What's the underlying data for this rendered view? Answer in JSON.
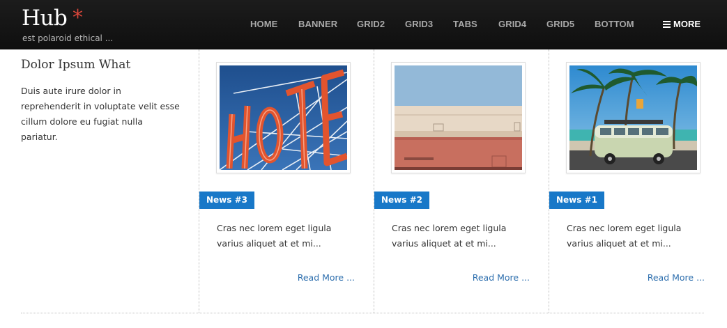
{
  "header": {
    "logo": "Hub",
    "logo_mark": "*",
    "tagline": "est polaroid ethical ...",
    "nav": [
      "HOME",
      "BANNER",
      "GRID2",
      "GRID3",
      "TABS",
      "GRID4",
      "GRID5",
      "BOTTOM"
    ],
    "more_label": "MORE",
    "more_icon": "menu-icon"
  },
  "intro": {
    "title": "Dolor Ipsum What",
    "text": "Duis aute irure dolor in reprehenderit in voluptate velit esse cillum dolore eu fugiat nulla pariatur."
  },
  "cards": [
    {
      "badge": "News #3",
      "excerpt": "Cras nec lorem eget ligula varius aliquet at et mi...",
      "read_more": "Read More ...",
      "image": "hotel-sign-photo"
    },
    {
      "badge": "News #2",
      "excerpt": "Cras nec lorem eget ligula varius aliquet at et mi...",
      "read_more": "Read More ...",
      "image": "building-wall-photo"
    },
    {
      "badge": "News #1",
      "excerpt": "Cras nec lorem eget ligula varius aliquet at et mi...",
      "read_more": "Read More ...",
      "image": "beach-van-photo"
    }
  ],
  "colors": {
    "header_bg": "#141414",
    "accent": "#1878c8",
    "logo_mark": "#d9463a",
    "link": "#2e6fae"
  }
}
